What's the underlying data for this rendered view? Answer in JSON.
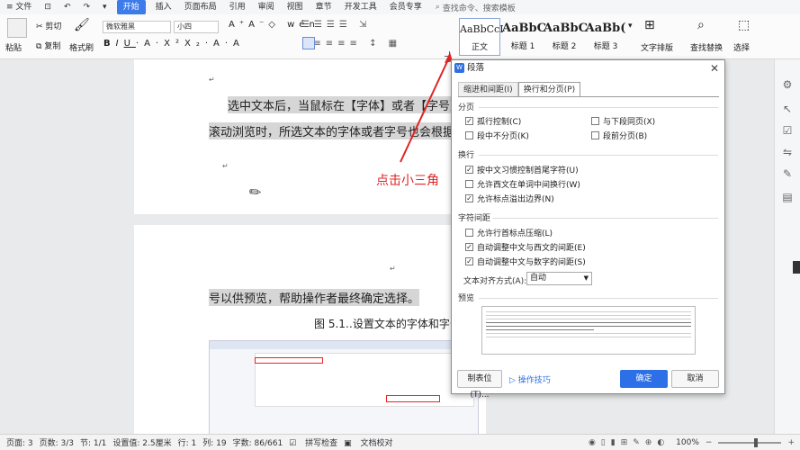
{
  "menubar": {
    "items": [
      "≡ 文件",
      "⊡",
      "↶",
      "↷",
      "▾",
      "开始",
      "插入",
      "页面布局",
      "引用",
      "审阅",
      "视图",
      "章节",
      "开发工具",
      "会员专享"
    ],
    "active_index": 5,
    "search": "查找命令、搜索模板"
  },
  "ribbon": {
    "paste": "粘贴",
    "cut": "剪切",
    "copy": "复制",
    "format_painter": "格式刷",
    "font_name": "微软雅黑",
    "font_size": "小四",
    "styles": [
      {
        "preview": "AaBbCcI",
        "label": "正文"
      },
      {
        "preview": "AaBbC",
        "label": "标题 1"
      },
      {
        "preview": "AaBbC",
        "label": "标题 2"
      },
      {
        "preview": "AaBb(",
        "label": "标题 3"
      }
    ],
    "text_layout": "文字排版",
    "find_replace": "查找替换",
    "select": "选择"
  },
  "document": {
    "page1_lines": [
      "选中文本后，当鼠标在【字体】或者【字号】下拉列",
      "滚动浏览时，所选文本的字体或者字号也会根据鼠标的移"
    ],
    "page2_lines": [
      "号以供预览，帮助操作者最终确定选择。",
      "图 5.1‥设置文本的字体和字号"
    ]
  },
  "annotation": {
    "text": "点击小三角"
  },
  "dialog": {
    "title": "段落",
    "tabs": [
      "缩进和间距(I)",
      "换行和分页(P)"
    ],
    "active_tab": 1,
    "sections": {
      "pagination": "分页",
      "line_break": "换行",
      "char_spacing": "字符间距",
      "preview": "预览"
    },
    "pagination": [
      {
        "label": "孤行控制(C)",
        "checked": true
      },
      {
        "label": "与下段同页(X)",
        "checked": false
      },
      {
        "label": "段中不分页(K)",
        "checked": false
      },
      {
        "label": "段前分页(B)",
        "checked": false
      }
    ],
    "line_break": [
      {
        "label": "按中文习惯控制首尾字符(U)",
        "checked": true
      },
      {
        "label": "允许西文在单词中间换行(W)",
        "checked": false
      },
      {
        "label": "允许标点溢出边界(N)",
        "checked": true
      }
    ],
    "char_spacing": [
      {
        "label": "允许行首标点压缩(L)",
        "checked": false
      },
      {
        "label": "自动调整中文与西文的间距(E)",
        "checked": true
      },
      {
        "label": "自动调整中文与数字的间距(S)",
        "checked": true
      }
    ],
    "align_label": "文本对齐方式(A):",
    "align_value": "自动",
    "tab_stops": "制表位(T)...",
    "tips": "操作技巧",
    "ok": "确定",
    "cancel": "取消"
  },
  "statusbar": {
    "items": [
      "页面: 3",
      "页数: 3/3",
      "节: 1/1",
      "设置值: 2.5厘米",
      "行: 1",
      "列: 19",
      "字数: 86/661",
      "拼写检查",
      "文档校对"
    ],
    "zoom": "100%"
  },
  "colors": {
    "accent": "#2d6fe6",
    "annotation": "#e02424"
  }
}
